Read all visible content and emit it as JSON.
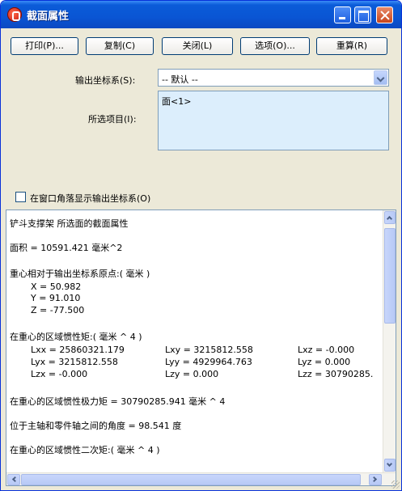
{
  "window": {
    "title": "截面属性",
    "minimize_icon": "minimize-icon",
    "maximize_icon": "maximize-icon",
    "close_icon": "close-icon"
  },
  "toolbar": {
    "print": "打印(P)...",
    "copy": "复制(C)",
    "close": "关闭(L)",
    "options": "选项(O)...",
    "recalc": "重算(R)"
  },
  "coord_system": {
    "label": "输出坐标系(S):",
    "value": "-- 默认 --"
  },
  "selected_items": {
    "label": "所选项目(I):",
    "items": [
      "面<1>"
    ]
  },
  "show_coord_checkbox": {
    "label": "在窗口角落显示输出坐标系(O)",
    "checked": false
  },
  "results": {
    "heading": "铲斗支撑架 所选面的截面属性",
    "area": "面积 = 10591.421 毫米^2",
    "centroid_heading": "重心相对于输出坐标系原点:( 毫米 )",
    "centroid": [
      "X = 50.982",
      "Y = 91.010",
      "Z = -77.500"
    ],
    "inertia_heading": "在重心的区域惯性矩:( 毫米 ^ 4 )",
    "inertia_rows": [
      [
        "Lxx = 25860321.179",
        "Lxy = 3215812.558",
        "Lxz = -0.000"
      ],
      [
        "Lyx = 3215812.558",
        "Lyy = 4929964.763",
        "Lyz = 0.000"
      ],
      [
        "Lzx = -0.000",
        "Lzy = 0.000",
        "Lzz = 30790285."
      ]
    ],
    "polar_moment": "在重心的区域惯性极力矩 = 30790285.941 毫米 ^ 4",
    "angle": "位于主轴和零件轴之间的角度 = 98.541 度",
    "second_moment_heading": "在重心的区域惯性二次矩:( 毫米 ^ 4 )"
  }
}
